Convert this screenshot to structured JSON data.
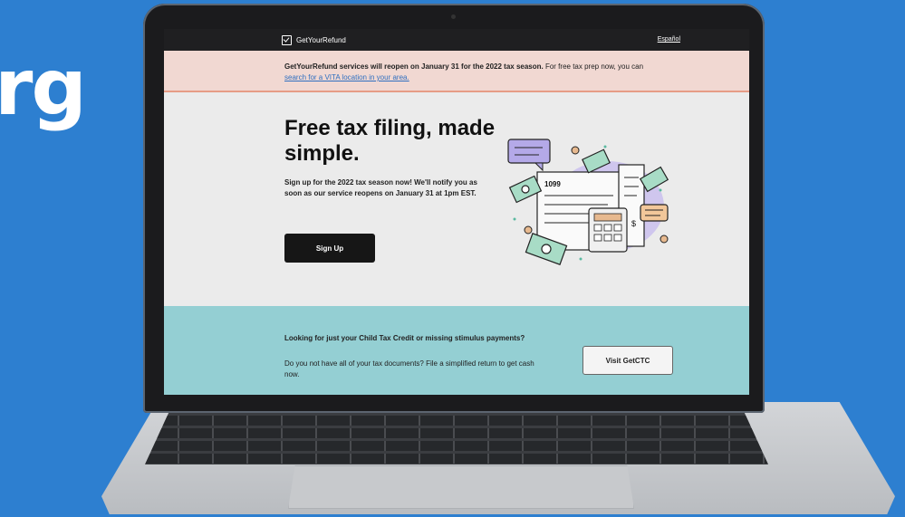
{
  "background": {
    "partial_text": "rg",
    "color": "#2d7fd0"
  },
  "site": {
    "brand": "GetYourRefund",
    "brand_icon": "checkbox-icon",
    "language_link": "Español"
  },
  "alert": {
    "bold": "GetYourRefund services will reopen on January 31 for the 2022 tax season.",
    "text": " For free tax prep now, you can ",
    "link": "search for a VITA location in your area.",
    "bg_color": "#f1d8d2"
  },
  "hero": {
    "title": "Free tax filing, made simple.",
    "subtitle": "Sign up for the 2022 tax season now! We'll notify you as soon as our service reopens on January 31 at 1pm EST.",
    "signup_label": "Sign Up",
    "form_label": "1099"
  },
  "ctc": {
    "heading": "Looking for just your Child Tax Credit or missing stimulus payments?",
    "body": "Do you not have all of your tax documents? File a simplified return to get cash now.",
    "button_label": "Visit GetCTC",
    "bg_color": "#94cfd3"
  }
}
